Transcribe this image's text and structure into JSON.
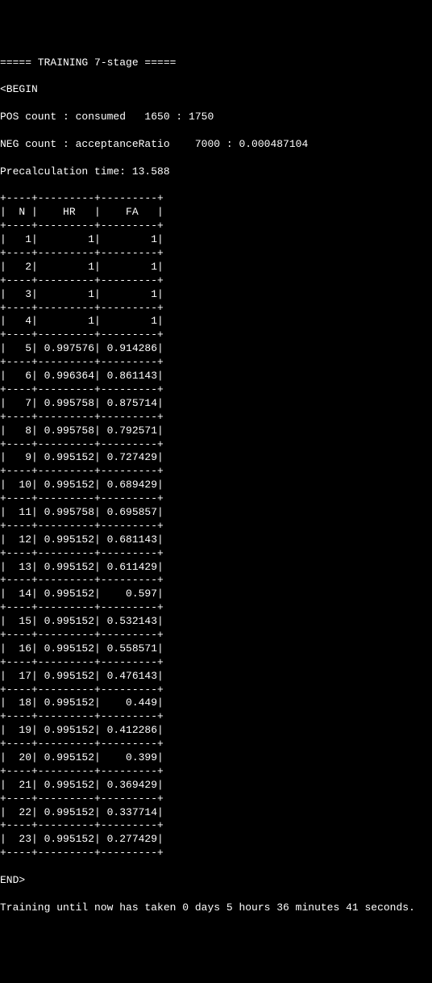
{
  "header": {
    "title_line": "===== TRAINING 7-stage =====",
    "begin_tag": "<BEGIN",
    "pos_line": "POS count : consumed   1650 : 1750",
    "neg_line": "NEG count : acceptanceRatio    7000 : 0.000487104",
    "precalc_line": "Precalculation time: 13.588"
  },
  "table": {
    "col_headers": [
      "N",
      "HR",
      "FA"
    ],
    "rows": [
      {
        "n": "1",
        "hr": "1",
        "fa": "1"
      },
      {
        "n": "2",
        "hr": "1",
        "fa": "1"
      },
      {
        "n": "3",
        "hr": "1",
        "fa": "1"
      },
      {
        "n": "4",
        "hr": "1",
        "fa": "1"
      },
      {
        "n": "5",
        "hr": "0.997576",
        "fa": "0.914286"
      },
      {
        "n": "6",
        "hr": "0.996364",
        "fa": "0.861143"
      },
      {
        "n": "7",
        "hr": "0.995758",
        "fa": "0.875714"
      },
      {
        "n": "8",
        "hr": "0.995758",
        "fa": "0.792571"
      },
      {
        "n": "9",
        "hr": "0.995152",
        "fa": "0.727429"
      },
      {
        "n": "10",
        "hr": "0.995152",
        "fa": "0.689429"
      },
      {
        "n": "11",
        "hr": "0.995758",
        "fa": "0.695857"
      },
      {
        "n": "12",
        "hr": "0.995152",
        "fa": "0.681143"
      },
      {
        "n": "13",
        "hr": "0.995152",
        "fa": "0.611429"
      },
      {
        "n": "14",
        "hr": "0.995152",
        "fa": "0.597"
      },
      {
        "n": "15",
        "hr": "0.995152",
        "fa": "0.532143"
      },
      {
        "n": "16",
        "hr": "0.995152",
        "fa": "0.558571"
      },
      {
        "n": "17",
        "hr": "0.995152",
        "fa": "0.476143"
      },
      {
        "n": "18",
        "hr": "0.995152",
        "fa": "0.449"
      },
      {
        "n": "19",
        "hr": "0.995152",
        "fa": "0.412286"
      },
      {
        "n": "20",
        "hr": "0.995152",
        "fa": "0.399"
      },
      {
        "n": "21",
        "hr": "0.995152",
        "fa": "0.369429"
      },
      {
        "n": "22",
        "hr": "0.995152",
        "fa": "0.337714"
      },
      {
        "n": "23",
        "hr": "0.995152",
        "fa": "0.277429"
      }
    ]
  },
  "footer": {
    "end_tag": "END>",
    "timing_line": "Training until now has taken 0 days 5 hours 36 minutes 41 seconds."
  },
  "chart_data": {
    "type": "table",
    "title": "TRAINING 7-stage",
    "columns": [
      "N",
      "HR",
      "FA"
    ],
    "data": [
      [
        1,
        1,
        1
      ],
      [
        2,
        1,
        1
      ],
      [
        3,
        1,
        1
      ],
      [
        4,
        1,
        1
      ],
      [
        5,
        0.997576,
        0.914286
      ],
      [
        6,
        0.996364,
        0.861143
      ],
      [
        7,
        0.995758,
        0.875714
      ],
      [
        8,
        0.995758,
        0.792571
      ],
      [
        9,
        0.995152,
        0.727429
      ],
      [
        10,
        0.995152,
        0.689429
      ],
      [
        11,
        0.995758,
        0.695857
      ],
      [
        12,
        0.995152,
        0.681143
      ],
      [
        13,
        0.995152,
        0.611429
      ],
      [
        14,
        0.995152,
        0.597
      ],
      [
        15,
        0.995152,
        0.532143
      ],
      [
        16,
        0.995152,
        0.558571
      ],
      [
        17,
        0.995152,
        0.476143
      ],
      [
        18,
        0.995152,
        0.449
      ],
      [
        19,
        0.995152,
        0.412286
      ],
      [
        20,
        0.995152,
        0.399
      ],
      [
        21,
        0.995152,
        0.369429
      ],
      [
        22,
        0.995152,
        0.337714
      ],
      [
        23,
        0.995152,
        0.277429
      ]
    ]
  }
}
